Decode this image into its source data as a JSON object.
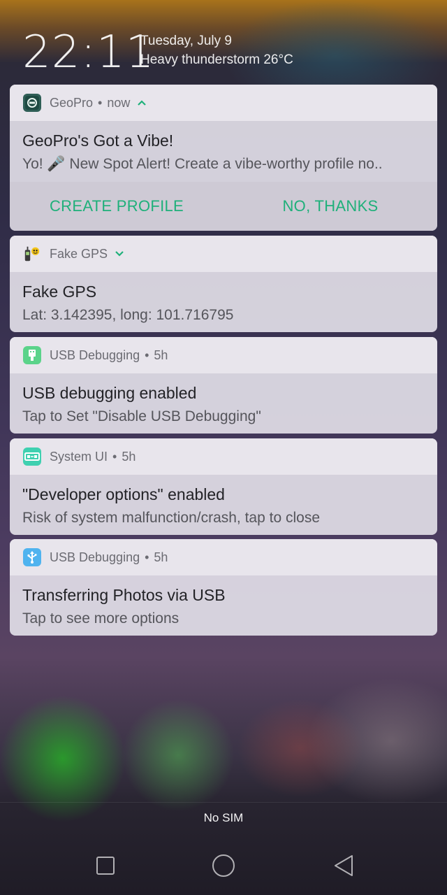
{
  "header": {
    "time": "22:11",
    "date": "Tuesday, July 9",
    "weather": "Heavy thunderstorm 26°C"
  },
  "notifications": [
    {
      "app": "GeoPro",
      "time": "now",
      "icon": "geopro-icon",
      "title": "GeoPro's Got a Vibe!",
      "text": "Yo! 🎤 New Spot Alert! Create a vibe-worthy profile no..",
      "actions": [
        "CREATE PROFILE",
        "NO, THANKS"
      ]
    },
    {
      "app": "Fake GPS",
      "icon": "fake-gps-icon",
      "title": "Fake GPS",
      "text": "Lat: 3.142395, long: 101.716795"
    },
    {
      "app": "USB Debugging",
      "time": "5h",
      "icon": "usb-debugging-icon",
      "title": "USB debugging enabled",
      "text": "Tap to Set \"Disable USB Debugging\""
    },
    {
      "app": "System UI",
      "time": "5h",
      "icon": "system-ui-icon",
      "title": "\"Developer options\" enabled",
      "text": "Risk of system malfunction/crash, tap to close"
    },
    {
      "app": "USB Debugging",
      "time": "5h",
      "icon": "usb-transfer-icon",
      "title": "Transferring Photos via USB",
      "text": "Tap to see more options"
    }
  ],
  "status": {
    "sim": "No SIM"
  },
  "navbar": {
    "buttons": [
      "recents-icon",
      "home-icon",
      "back-icon"
    ]
  },
  "colors": {
    "accent": "#1fb07a",
    "card": "#dedbe4"
  }
}
